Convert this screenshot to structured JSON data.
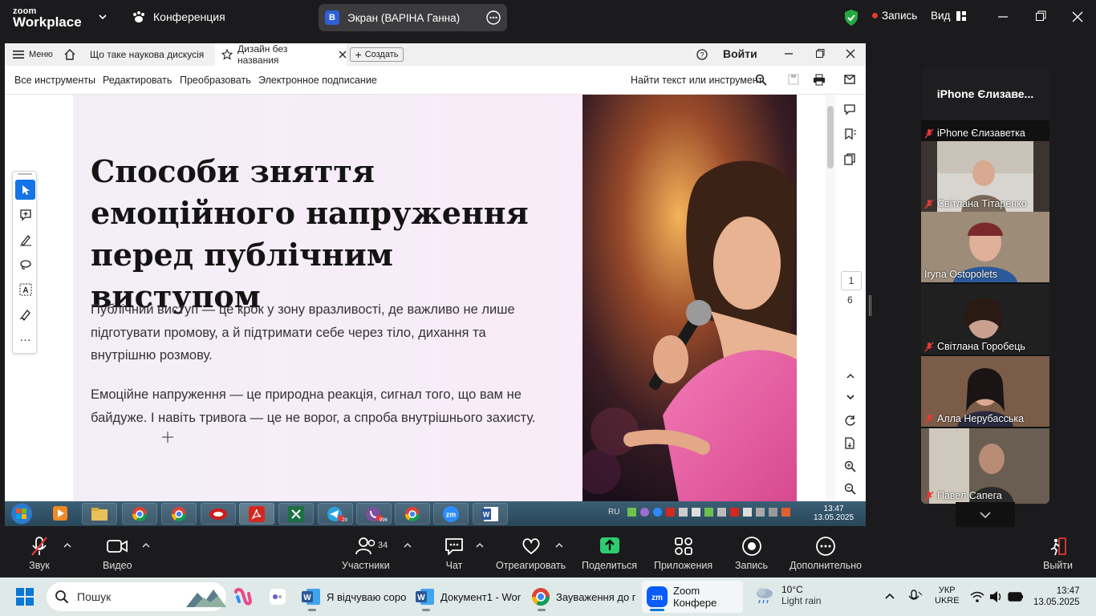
{
  "zoom": {
    "logo_line1": "zoom",
    "logo_line2": "Workplace",
    "meeting_label": "Конференция",
    "screen_badge": "В",
    "screen_label": "Экран (ВАРІНА Ганна)",
    "record_status": "Запись",
    "view_label": "Вид"
  },
  "acrobat": {
    "menu_label": "Меню",
    "tabs": [
      {
        "label": "Що таке наукова дискусія"
      },
      {
        "label": "Дизайн без названия"
      }
    ],
    "create_label": "Создать",
    "login_label": "Войти",
    "menu_items": [
      "Все инструменты",
      "Редактировать",
      "Преобразовать",
      "Электронное подписание"
    ],
    "find_label": "Найти текст или инструмент",
    "page_current": "1",
    "page_total": "6"
  },
  "slide": {
    "title": "Способи зняття емоційного напруження перед публічним виступом",
    "paragraph1": "Публічний виступ — це крок у зону вразливості, де важливо не лише підготувати промову, а й підтримати себе через тіло, дихання та внутрішню розмову.",
    "paragraph2": "Емоційне напруження — це природна реакція, сигнал того, що вам не байдуже. І навіть тривога — це не ворог, а спроба внутрішнього захисту."
  },
  "win7_taskbar": {
    "lang": "RU",
    "time": "13:47",
    "date": "13.05.2025",
    "telegram_badge": "29",
    "viber_badge": "996"
  },
  "gallery": {
    "title": "iPhone Єлизаве...",
    "participants": [
      {
        "name": "iPhone Єлизаветка"
      },
      {
        "name": "Світлана Тітаренко"
      },
      {
        "name": "Iryna Ostopolets"
      },
      {
        "name": "Світлана Горобець"
      },
      {
        "name": "Алла Нерубасська"
      },
      {
        "name": "Павел Сапега"
      }
    ]
  },
  "controls": {
    "audio": "Звук",
    "video": "Видео",
    "participants": "Участники",
    "participants_count": "34",
    "chat": "Чат",
    "react": "Отреагировать",
    "share": "Поделиться",
    "apps": "Приложения",
    "record": "Запись",
    "more": "Дополнительно",
    "leave": "Выйти"
  },
  "win11_taskbar": {
    "search_placeholder": "Пошук",
    "apps": [
      {
        "label": "Я відчуваю сорo"
      },
      {
        "label": "Документ1 - Wor"
      },
      {
        "label": "Зауваження до г"
      },
      {
        "label": "Zoom Конфере"
      }
    ],
    "weather_temp": "10°C",
    "weather_desc": "Light rain",
    "lang_line1": "УКР",
    "lang_line2": "UKRE",
    "time": "13:47",
    "date": "13.05.2025"
  },
  "colors": {
    "zoom_bg": "#1b1b1d",
    "record_red": "#e53935",
    "share_green": "#2ecc71",
    "acrobat_red": "#d4281f",
    "word_blue": "#2b579a"
  }
}
